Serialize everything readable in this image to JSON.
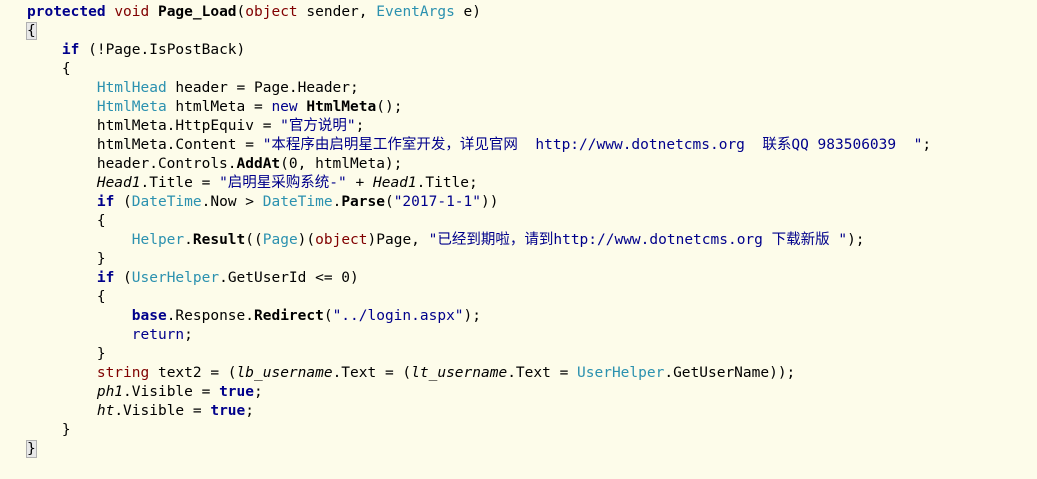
{
  "editor": {
    "lines": [
      [
        {
          "t": "protected",
          "c": "kw"
        },
        {
          "t": " "
        },
        {
          "t": "void",
          "c": "typekw"
        },
        {
          "t": " "
        },
        {
          "t": "Page_Load",
          "c": "method"
        },
        {
          "t": "("
        },
        {
          "t": "object",
          "c": "typekw"
        },
        {
          "t": " sender, "
        },
        {
          "t": "EventArgs",
          "c": "type"
        },
        {
          "t": " e)"
        }
      ],
      [
        {
          "t": "{",
          "c": "brace-hl"
        }
      ],
      [
        {
          "t": "    "
        },
        {
          "t": "if",
          "c": "kw"
        },
        {
          "t": " (!Page.IsPostBack)"
        }
      ],
      [
        {
          "t": "    {"
        }
      ],
      [
        {
          "t": "        "
        },
        {
          "t": "HtmlHead",
          "c": "type"
        },
        {
          "t": " header = Page.Header;"
        }
      ],
      [
        {
          "t": "        "
        },
        {
          "t": "HtmlMeta",
          "c": "type"
        },
        {
          "t": " htmlMeta = "
        },
        {
          "t": "new",
          "c": "kw2"
        },
        {
          "t": " "
        },
        {
          "t": "HtmlMeta",
          "c": "method"
        },
        {
          "t": "();"
        }
      ],
      [
        {
          "t": "        htmlMeta.HttpEquiv = "
        },
        {
          "t": "\"官方说明\"",
          "c": "str"
        },
        {
          "t": ";"
        }
      ],
      [
        {
          "t": "        htmlMeta.Content = "
        },
        {
          "t": "\"本程序由启明星工作室开发，详见官网  http://www.dotnetcms.org  联系QQ 983506039  \"",
          "c": "str"
        },
        {
          "t": ";"
        }
      ],
      [
        {
          "t": "        header.Controls."
        },
        {
          "t": "AddAt",
          "c": "method"
        },
        {
          "t": "(0, htmlMeta);"
        }
      ],
      [
        {
          "t": "        "
        },
        {
          "t": "Head1",
          "c": "italic"
        },
        {
          "t": ".Title = "
        },
        {
          "t": "\"启明星采购系统-\"",
          "c": "str"
        },
        {
          "t": " + "
        },
        {
          "t": "Head1",
          "c": "italic"
        },
        {
          "t": ".Title;"
        }
      ],
      [
        {
          "t": "        "
        },
        {
          "t": "if",
          "c": "kw"
        },
        {
          "t": " ("
        },
        {
          "t": "DateTime",
          "c": "type"
        },
        {
          "t": ".Now > "
        },
        {
          "t": "DateTime",
          "c": "type"
        },
        {
          "t": "."
        },
        {
          "t": "Parse",
          "c": "method"
        },
        {
          "t": "("
        },
        {
          "t": "\"2017-1-1\"",
          "c": "str"
        },
        {
          "t": "))"
        }
      ],
      [
        {
          "t": "        {"
        }
      ],
      [
        {
          "t": "            "
        },
        {
          "t": "Helper",
          "c": "type"
        },
        {
          "t": "."
        },
        {
          "t": "Result",
          "c": "method"
        },
        {
          "t": "(("
        },
        {
          "t": "Page",
          "c": "type"
        },
        {
          "t": ")("
        },
        {
          "t": "object",
          "c": "typekw"
        },
        {
          "t": ")Page, "
        },
        {
          "t": "\"已经到期啦，请到http://www.dotnetcms.org 下载新版 \"",
          "c": "str"
        },
        {
          "t": ");"
        }
      ],
      [
        {
          "t": "        }"
        }
      ],
      [
        {
          "t": "        "
        },
        {
          "t": "if",
          "c": "kw"
        },
        {
          "t": " ("
        },
        {
          "t": "UserHelper",
          "c": "type"
        },
        {
          "t": ".GetUserId <= 0)"
        }
      ],
      [
        {
          "t": "        {"
        }
      ],
      [
        {
          "t": "            "
        },
        {
          "t": "base",
          "c": "kw"
        },
        {
          "t": ".Response."
        },
        {
          "t": "Redirect",
          "c": "method"
        },
        {
          "t": "("
        },
        {
          "t": "\"../login.aspx\"",
          "c": "str"
        },
        {
          "t": ");"
        }
      ],
      [
        {
          "t": "            "
        },
        {
          "t": "return",
          "c": "kw2"
        },
        {
          "t": ";"
        }
      ],
      [
        {
          "t": "        }"
        }
      ],
      [
        {
          "t": "        "
        },
        {
          "t": "string",
          "c": "typekw"
        },
        {
          "t": " text2 = ("
        },
        {
          "t": "lb_username",
          "c": "italic"
        },
        {
          "t": ".Text = ("
        },
        {
          "t": "lt_username",
          "c": "italic"
        },
        {
          "t": ".Text = "
        },
        {
          "t": "UserHelper",
          "c": "type"
        },
        {
          "t": ".GetUserName));"
        }
      ],
      [
        {
          "t": "        "
        },
        {
          "t": "ph1",
          "c": "italic"
        },
        {
          "t": ".Visible = "
        },
        {
          "t": "true",
          "c": "kw"
        },
        {
          "t": ";"
        }
      ],
      [
        {
          "t": "        "
        },
        {
          "t": "ht",
          "c": "italic"
        },
        {
          "t": ".Visible = "
        },
        {
          "t": "true",
          "c": "kw"
        },
        {
          "t": ";"
        }
      ],
      [
        {
          "t": "    }"
        }
      ],
      [
        {
          "t": "}",
          "c": "brace-hl"
        }
      ]
    ]
  },
  "colors": {
    "background": "#fdfcea",
    "keyword": "#00008b",
    "type": "#2b91af",
    "type_keyword": "#800000",
    "string": "#00008b"
  }
}
